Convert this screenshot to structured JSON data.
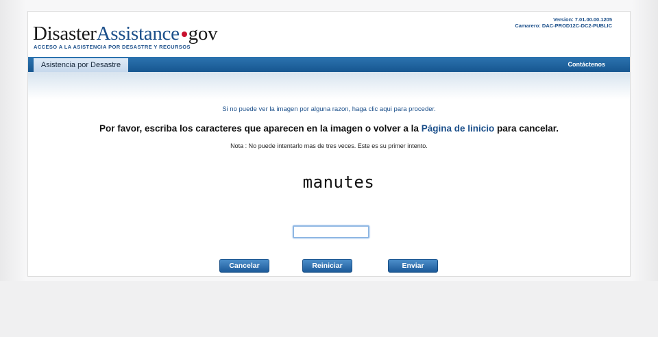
{
  "header": {
    "logo": {
      "word1": "Disaster",
      "word2": "Assistance",
      "word3": "gov"
    },
    "tagline": "ACCESO A LA ASISTENCIA POR DESASTRE Y RECURSOS",
    "version_line": "Version: 7.01.00.00.1205",
    "server_line": "Camarero: DAC-PROD12C-DC2-PUBLIC"
  },
  "nav": {
    "active_tab": "Asistencia por Desastre",
    "contact": "Contáctenos"
  },
  "content": {
    "skip_link": "Si no puede ver la imagen por alguna razon, haga clic aqui para proceder.",
    "instruction_before": "Por favor, escriba los caracteres que aparecen en la imagen o volver a la ",
    "instruction_link": "Página de Iinicio",
    "instruction_after": " para cancelar.",
    "note": "Nota : No puede intentarlo mas de tres veces. Este es su primer intento.",
    "captcha_text": "manutes",
    "input_value": "",
    "input_placeholder": ""
  },
  "buttons": {
    "cancel": "Cancelar",
    "reset": "Reiniciar",
    "send": "Enviar"
  },
  "colors": {
    "brand_blue": "#1b4f8a",
    "nav_blue": "#2c74b0",
    "dot_red": "#c8102e"
  }
}
